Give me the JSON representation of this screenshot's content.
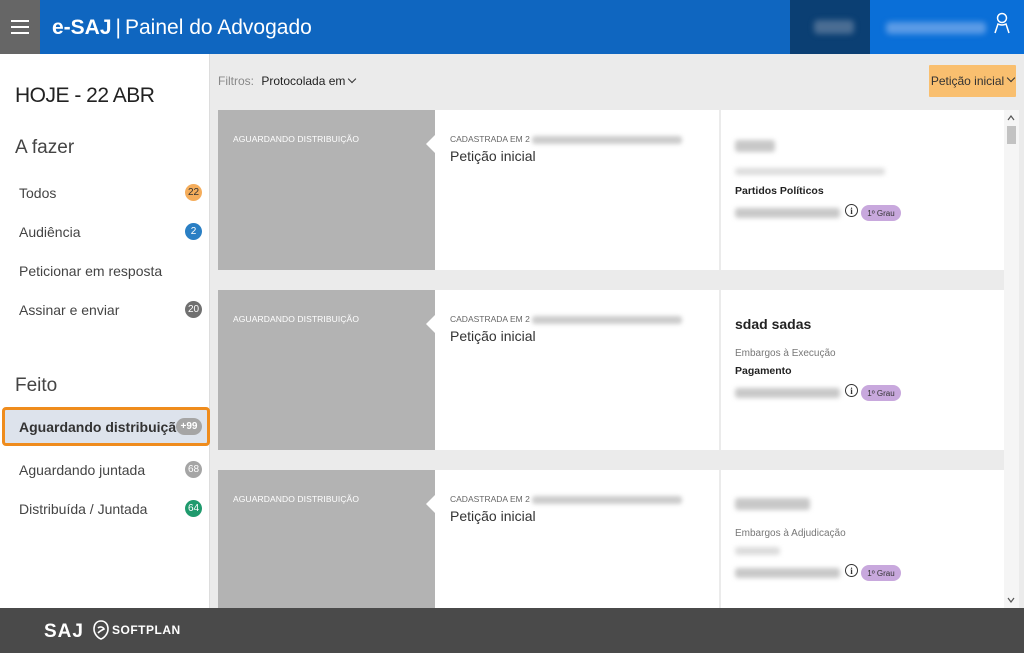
{
  "header": {
    "app_name": "e-SAJ",
    "separator": "|",
    "title": "Painel do Advogado"
  },
  "sidebar": {
    "today": "HOJE - 22 ABR",
    "todo_title": "A fazer",
    "todo_items": [
      {
        "label": "Todos",
        "count": "22",
        "color": "#f5ad5b"
      },
      {
        "label": "Audiência",
        "count": "2",
        "color": "#2a7fc4"
      },
      {
        "label": "Peticionar em resposta",
        "count": ""
      },
      {
        "label": "Assinar e enviar",
        "count": "20",
        "color": "#707070"
      }
    ],
    "done_title": "Feito",
    "done_items": [
      {
        "label": "Aguardando distribuição",
        "count": "+99",
        "active": true
      },
      {
        "label": "Aguardando juntada",
        "count": "68",
        "color": "#a5a5a5"
      },
      {
        "label": "Distribuída / Juntada",
        "count": "64",
        "color": "#1f9a6d"
      }
    ]
  },
  "filters": {
    "label": "Filtros:",
    "value": "Protocolada em"
  },
  "petition_button": "Petição inicial",
  "cards": [
    {
      "status": "AGUARDANDO DISTRIBUIÇÃO",
      "registered_label": "CADASTRADA EM 2",
      "petition_type": "Petição inicial",
      "title": "",
      "class": "",
      "subject": "Partidos Políticos",
      "grau": "1º Grau"
    },
    {
      "status": "AGUARDANDO DISTRIBUIÇÃO",
      "registered_label": "CADASTRADA EM 2",
      "petition_type": "Petição inicial",
      "title": "sdad sadas",
      "class": "Embargos à Execução",
      "subject": "Pagamento",
      "grau": "1º Grau"
    },
    {
      "status": "AGUARDANDO DISTRIBUIÇÃO",
      "registered_label": "CADASTRADA EM 2",
      "petition_type": "Petição inicial",
      "title": "",
      "class": "Embargos à Adjudicação",
      "subject": "",
      "grau": "1º Grau"
    }
  ],
  "footer": {
    "saj": "SAJ",
    "softplan": "SOFTPLAN"
  },
  "icons": [
    "menu-icon",
    "user-icon",
    "chevron-down-icon",
    "info-icon",
    "scroll-up-icon",
    "scroll-down-icon",
    "softplan-logo-icon"
  ]
}
